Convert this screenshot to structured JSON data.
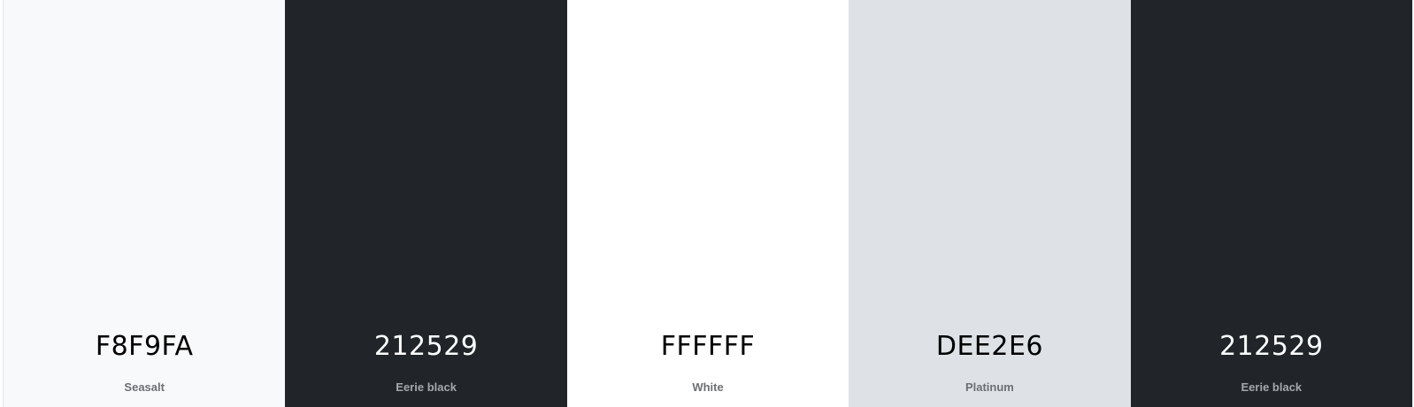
{
  "palette": {
    "swatches": [
      {
        "hex": "F8F9FA",
        "name": "Seasalt",
        "color": "#F8F9FA",
        "text_color": "#000000",
        "name_color": "#6c6f73"
      },
      {
        "hex": "212529",
        "name": "Eerie black",
        "color": "#212529",
        "text_color": "#ffffff",
        "name_color": "#a4a7ab"
      },
      {
        "hex": "FFFFFF",
        "name": "White",
        "color": "#FFFFFF",
        "text_color": "#000000",
        "name_color": "#6c6f73"
      },
      {
        "hex": "DEE2E6",
        "name": "Platinum",
        "color": "#DEE2E6",
        "text_color": "#000000",
        "name_color": "#6c6f73"
      },
      {
        "hex": "212529",
        "name": "Eerie black",
        "color": "#212529",
        "text_color": "#ffffff",
        "name_color": "#a4a7ab"
      }
    ]
  }
}
